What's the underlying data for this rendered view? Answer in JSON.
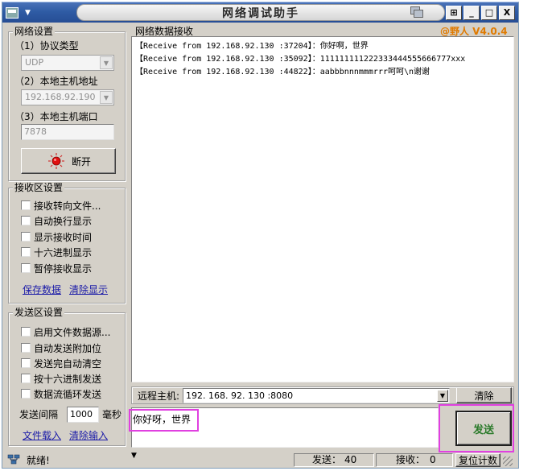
{
  "window": {
    "title": "网络调试助手",
    "controls": {
      "restore": "⊞",
      "minimize": "_",
      "maximize": "□",
      "close": "X"
    }
  },
  "brand": {
    "text": "@野人 V4.0.4",
    "color": "#e07a00"
  },
  "network_settings": {
    "group_label": "网络设置",
    "protocol_label": "（1）协议类型",
    "protocol_value": "UDP",
    "host_label": "（2）本地主机地址",
    "host_value": "192.168.92.190",
    "port_label": "（3）本地主机端口",
    "port_value": "7878",
    "connect_button": "断开"
  },
  "receive_settings": {
    "group_label": "接收区设置",
    "options": [
      "接收转向文件...",
      "自动换行显示",
      "显示接收时间",
      "十六进制显示",
      "暂停接收显示"
    ],
    "save_link": "保存数据",
    "clear_link": "清除显示"
  },
  "send_settings": {
    "group_label": "发送区设置",
    "options": [
      "启用文件数据源...",
      "自动发送附加位",
      "发送完自动清空",
      "按十六进制发送",
      "数据流循环发送"
    ],
    "interval_label": "发送间隔",
    "interval_value": "1000",
    "interval_unit": "毫秒",
    "load_link": "文件载入",
    "clear_link": "清除输入"
  },
  "receive_area": {
    "group_label": "网络数据接收",
    "lines": [
      "【Receive from 192.168.92.130 :37204】：你好啊，世界",
      "【Receive from 192.168.92.130 :35092】：111111111222333444555666777xxx",
      "【Receive from 192.168.92.130 :44822】：aabbbnnnmmmrrr呵呵\\n谢谢"
    ]
  },
  "remote": {
    "label": "远程主机:",
    "value": "192. 168. 92. 130  :8080",
    "clear_button": "清除"
  },
  "send_area": {
    "text": "你好呀，世界",
    "send_button": "发送",
    "send_button_color": "#2a7a2a"
  },
  "status": {
    "ready": "就绪!",
    "sent_label": "发送：",
    "sent_value": "40",
    "recv_label": "接收：",
    "recv_value": "0",
    "reset_button": "复位计数"
  },
  "highlight_color": "#e040e0"
}
